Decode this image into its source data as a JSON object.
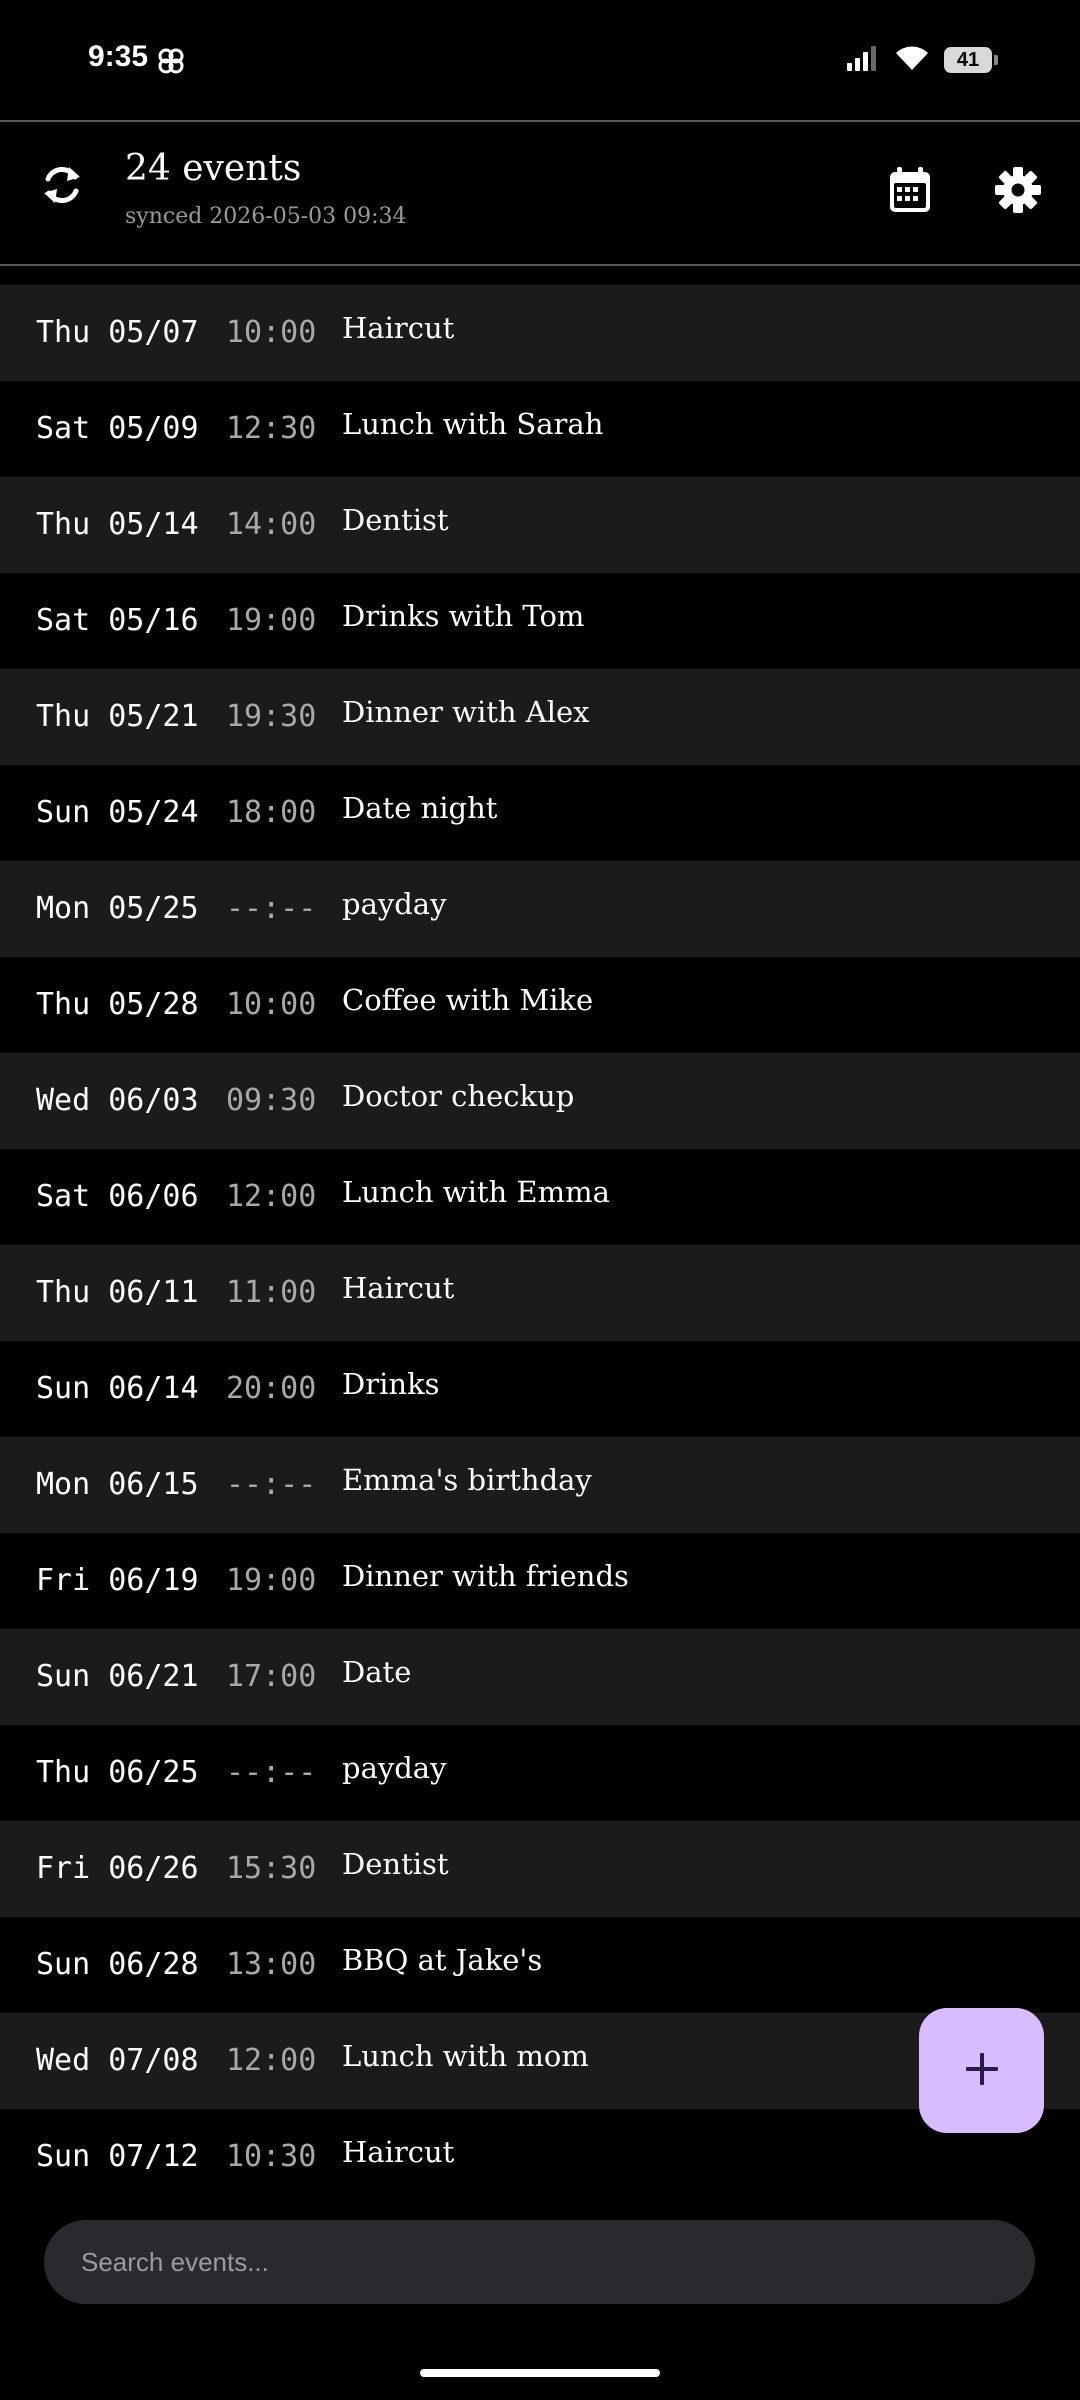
{
  "status_bar": {
    "time": "9:35",
    "battery": "41",
    "icons": [
      "pinwheel-notification-icon",
      "signal-icon",
      "wifi-icon",
      "battery-icon"
    ]
  },
  "header": {
    "title": "24 events",
    "subtitle": "synced 2026-05-03 09:34",
    "icons": [
      "sync-icon",
      "calendar-icon",
      "gear-icon"
    ]
  },
  "events": [
    {
      "date": "Thu 05/07",
      "time": "10:00",
      "title": "Haircut"
    },
    {
      "date": "Sat 05/09",
      "time": "12:30",
      "title": "Lunch with Sarah"
    },
    {
      "date": "Thu 05/14",
      "time": "14:00",
      "title": "Dentist"
    },
    {
      "date": "Sat 05/16",
      "time": "19:00",
      "title": "Drinks with Tom"
    },
    {
      "date": "Thu 05/21",
      "time": "19:30",
      "title": "Dinner with Alex"
    },
    {
      "date": "Sun 05/24",
      "time": "18:00",
      "title": "Date night"
    },
    {
      "date": "Mon 05/25",
      "time": "--:--",
      "title": "payday"
    },
    {
      "date": "Thu 05/28",
      "time": "10:00",
      "title": "Coffee with Mike"
    },
    {
      "date": "Wed 06/03",
      "time": "09:30",
      "title": "Doctor checkup"
    },
    {
      "date": "Sat 06/06",
      "time": "12:00",
      "title": "Lunch with Emma"
    },
    {
      "date": "Thu 06/11",
      "time": "11:00",
      "title": "Haircut"
    },
    {
      "date": "Sun 06/14",
      "time": "20:00",
      "title": "Drinks"
    },
    {
      "date": "Mon 06/15",
      "time": "--:--",
      "title": "Emma's birthday"
    },
    {
      "date": "Fri 06/19",
      "time": "19:00",
      "title": "Dinner with friends"
    },
    {
      "date": "Sun 06/21",
      "time": "17:00",
      "title": "Date"
    },
    {
      "date": "Thu 06/25",
      "time": "--:--",
      "title": "payday"
    },
    {
      "date": "Fri 06/26",
      "time": "15:30",
      "title": "Dentist"
    },
    {
      "date": "Sun 06/28",
      "time": "13:00",
      "title": "BBQ at Jake's"
    },
    {
      "date": "Wed 07/08",
      "time": "12:00",
      "title": "Lunch with mom"
    },
    {
      "date": "Sun 07/12",
      "time": "10:30",
      "title": "Haircut"
    }
  ],
  "fab": {
    "icon": "plus-icon",
    "color": "#d7bcff"
  },
  "search": {
    "placeholder": "Search events..."
  },
  "colors": {
    "background": "#000000",
    "row_alt": "#1b1b1b",
    "accent": "#d7bcff",
    "muted_text": "#a8a8a8"
  }
}
